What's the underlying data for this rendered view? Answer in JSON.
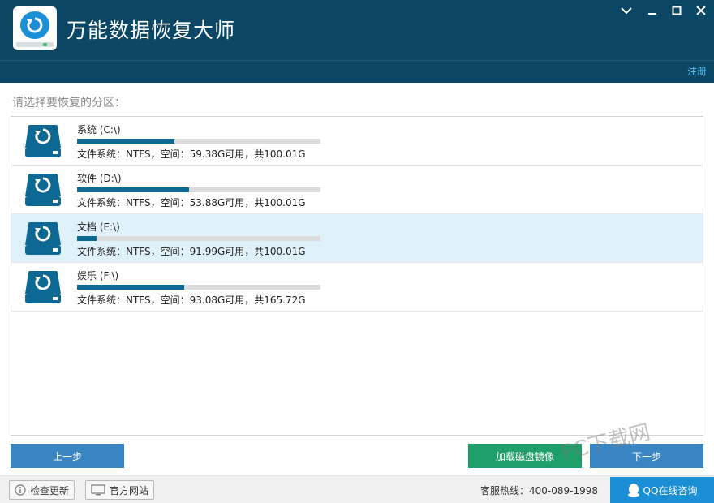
{
  "app": {
    "title": "万能数据恢复大师",
    "register": "注册"
  },
  "prompt": "请选择要恢复的分区：",
  "partitions": [
    {
      "name": "系统 (C:\\)",
      "used_fraction": 0.4,
      "info": "文件系统：NTFS，空间：59.38G可用，共100.01G",
      "selected": false
    },
    {
      "name": "软件 (D:\\)",
      "used_fraction": 0.46,
      "info": "文件系统：NTFS，空间：53.88G可用，共100.01G",
      "selected": false
    },
    {
      "name": "文档 (E:\\)",
      "used_fraction": 0.08,
      "info": "文件系统：NTFS，空间：91.99G可用，共100.01G",
      "selected": true
    },
    {
      "name": "娱乐 (F:\\)",
      "used_fraction": 0.44,
      "info": "文件系统：NTFS，空间：93.08G可用，共165.72G",
      "selected": false
    }
  ],
  "buttons": {
    "prev": "上一步",
    "mount": "加载磁盘镜像",
    "next": "下一步"
  },
  "footer": {
    "check_update": "检查更新",
    "website": "官方网站",
    "hotline": "客服热线：400-089-1998",
    "qq": "QQ在线咨询"
  },
  "watermark": "PC下载网",
  "colors": {
    "header": "#0b4664",
    "accent": "#3a86c4",
    "green": "#1e9e68",
    "bar": "#0e6894",
    "selected_row": "#dff1f9"
  },
  "icons": [
    "refresh-drive-icon",
    "minimize-icon",
    "maximize-icon",
    "close-icon",
    "chevron-down-icon",
    "info-icon",
    "monitor-icon",
    "qq-penguin-icon"
  ]
}
